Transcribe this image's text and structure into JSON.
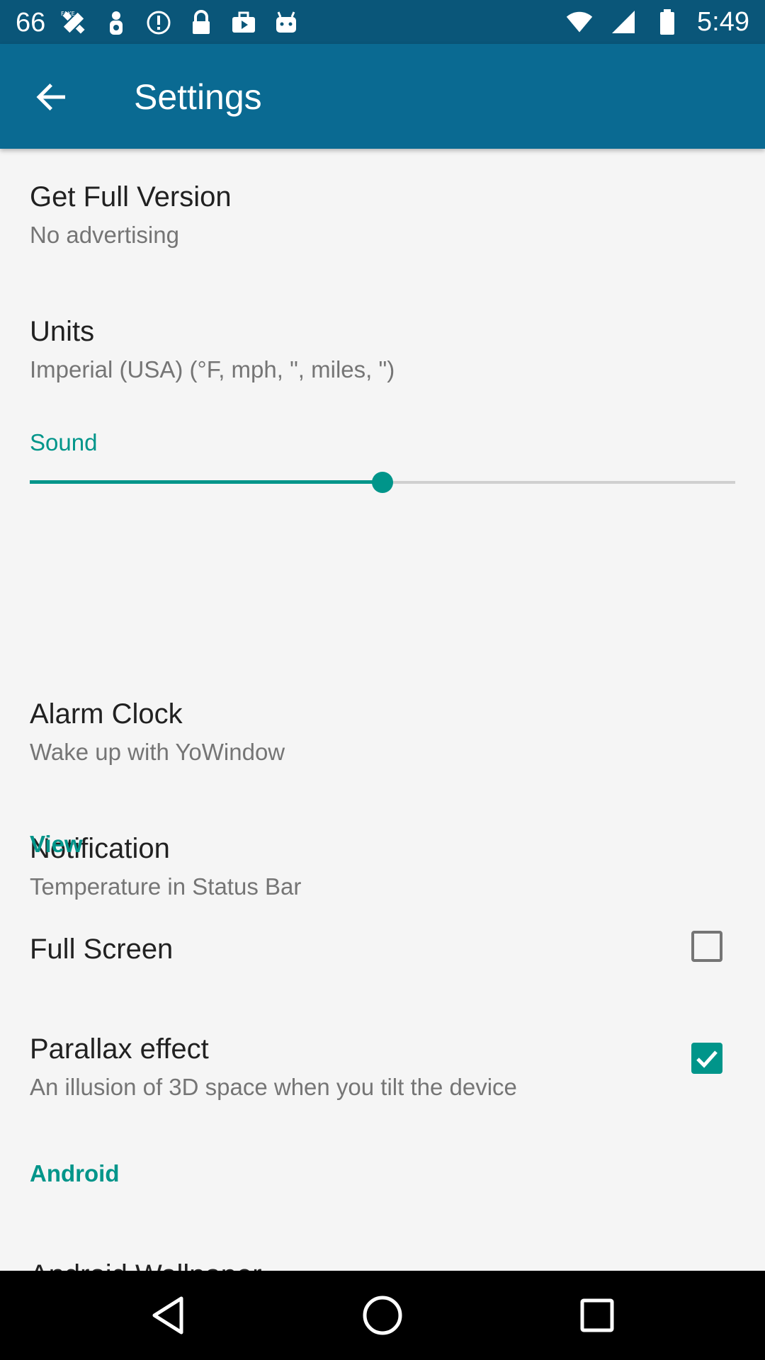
{
  "status_bar": {
    "notification_text": "66",
    "time": "5:49",
    "icons": [
      "fake-gps-icon",
      "person-icon",
      "info-icon",
      "lock-icon",
      "briefcase-icon",
      "android-icon",
      "wifi-icon",
      "signal-icon",
      "battery-icon"
    ]
  },
  "app_bar": {
    "title": "Settings",
    "back_icon": "arrow-back-icon"
  },
  "prefs": {
    "full_version": {
      "title": "Get Full Version",
      "summary": "No advertising"
    },
    "units": {
      "title": "Units",
      "summary": "Imperial (USA) (°F, mph, \", miles, \")"
    },
    "sound": {
      "title": "Sound",
      "level": 0.5
    },
    "alarm": {
      "title": "Alarm Clock",
      "summary": "Wake up with YoWindow"
    },
    "notification": {
      "title": "Notification",
      "summary": "Temperature in Status Bar"
    },
    "view_category": "View",
    "full_screen": {
      "title": "Full Screen",
      "checked": false
    },
    "parallax": {
      "title": "Parallax effect",
      "summary": "An illusion of 3D space when you tilt the device",
      "checked": true
    },
    "android_category": "Android",
    "android_wallpaper": {
      "title": "Android Wallpaper"
    }
  },
  "colors": {
    "status_bar": "#0a5679",
    "app_bar": "#0a6a92",
    "accent": "#00958a",
    "background": "#f5f5f5"
  },
  "nav_bar": {
    "icons": [
      "back-triangle-icon",
      "home-circle-icon",
      "recents-square-icon"
    ]
  }
}
